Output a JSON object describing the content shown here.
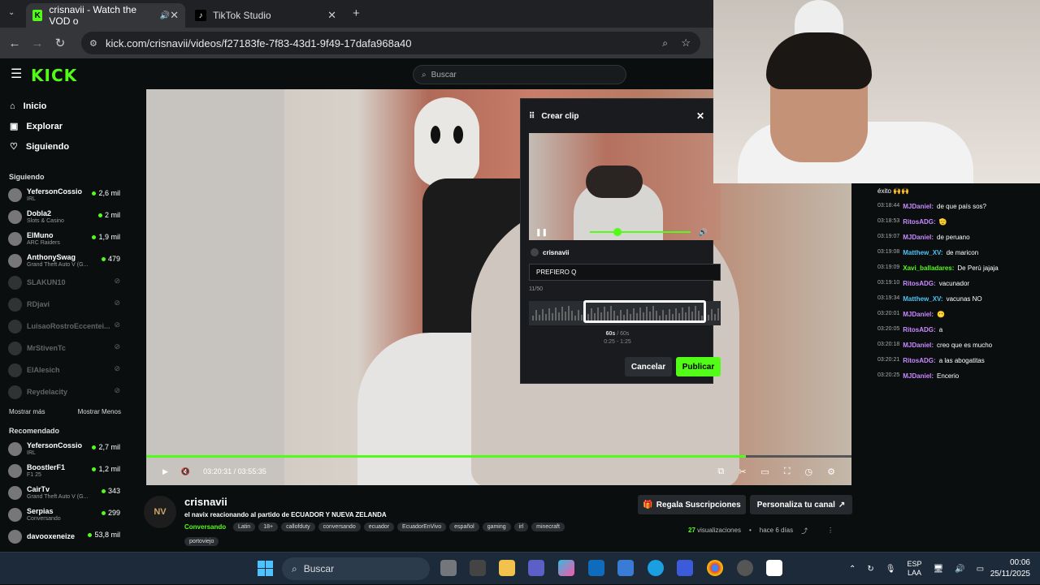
{
  "browser": {
    "tabs": [
      {
        "title": "crisnavii - Watch the VOD o"
      },
      {
        "title": "TikTok Studio"
      }
    ],
    "url": "kick.com/crisnavii/videos/f27183fe-7f83-43d1-9f49-17dafa968a40"
  },
  "header": {
    "logo": "KICK",
    "search_placeholder": "Buscar"
  },
  "sidebar": {
    "nav": [
      {
        "label": "Inicio"
      },
      {
        "label": "Explorar"
      },
      {
        "label": "Siguiendo"
      }
    ],
    "following_title": "Siguiendo",
    "following": [
      {
        "name": "YefersonCossio",
        "game": "IRL",
        "viewers": "2,6 mil",
        "live": true
      },
      {
        "name": "Dobla2",
        "game": "Slots & Casino",
        "viewers": "2 mil",
        "live": true
      },
      {
        "name": "ElMuno",
        "game": "ARC Raiders",
        "viewers": "1,9 mil",
        "live": true
      },
      {
        "name": "AnthonySwag",
        "game": "Grand Theft Auto V (G...",
        "viewers": "479",
        "live": true
      },
      {
        "name": "SLAKUN10",
        "game": "",
        "viewers": "",
        "live": false
      },
      {
        "name": "RDjavi",
        "game": "",
        "viewers": "",
        "live": false
      },
      {
        "name": "LuisaoRostroEccentei...",
        "game": "",
        "viewers": "",
        "live": false
      },
      {
        "name": "MrStivenTc",
        "game": "",
        "viewers": "",
        "live": false
      },
      {
        "name": "ElAlesich",
        "game": "",
        "viewers": "",
        "live": false
      },
      {
        "name": "Reydelacity",
        "game": "",
        "viewers": "",
        "live": false
      }
    ],
    "show_more": "Mostrar más",
    "show_less": "Mostrar Menos",
    "recommended_title": "Recomendado",
    "recommended": [
      {
        "name": "YefersonCossio",
        "game": "IRL",
        "viewers": "2,7 mil"
      },
      {
        "name": "BoostIerF1",
        "game": "F1 25",
        "viewers": "1,2 mil"
      },
      {
        "name": "CairTv",
        "game": "Grand Theft Auto V (G...",
        "viewers": "343"
      },
      {
        "name": "Serpias",
        "game": "Conversando",
        "viewers": "299"
      },
      {
        "name": "davooxeneize",
        "game": "",
        "viewers": "53,8 mil"
      }
    ]
  },
  "player": {
    "time": "03:20:31 / 03:55:35",
    "progress": 0.85
  },
  "clip": {
    "title": "Crear clip",
    "channel": "crisnavii",
    "input_value": "PREFIERO Q",
    "char_count": "11/50",
    "duration": "60s",
    "duration_max": "/ 60s",
    "range": "0:25 - 1:25",
    "cancel": "Cancelar",
    "publish": "Publicar"
  },
  "chat": [
    {
      "ts": "",
      "user": "",
      "text": "éxito 🙌🙌",
      "color": "#ffffff"
    },
    {
      "ts": "03:18:44",
      "user": "MJDaniel:",
      "text": "de que país sos?",
      "color": "#c88bff"
    },
    {
      "ts": "03:18:53",
      "user": "RitosADG:",
      "text": "🫡",
      "color": "#c88bff"
    },
    {
      "ts": "03:19:07",
      "user": "MJDaniel:",
      "text": "de peruano",
      "color": "#c88bff"
    },
    {
      "ts": "03:19:08",
      "user": "Matthew_XV:",
      "text": "de maricon",
      "color": "#4fc3f7"
    },
    {
      "ts": "03:19:09",
      "user": "Xavi_balladares:",
      "text": "De Perú jajaja",
      "color": "#53fc18"
    },
    {
      "ts": "03:19:10",
      "user": "RitosADG:",
      "text": "vacunador",
      "color": "#c88bff"
    },
    {
      "ts": "03:19:34",
      "user": "Matthew_XV:",
      "text": "vacunas NO",
      "color": "#4fc3f7"
    },
    {
      "ts": "03:20:01",
      "user": "MJDaniel:",
      "text": "😶",
      "color": "#c88bff"
    },
    {
      "ts": "03:20:05",
      "user": "RitosADG:",
      "text": "a",
      "color": "#c88bff"
    },
    {
      "ts": "03:20:18",
      "user": "MJDaniel:",
      "text": "creo que es mucho",
      "color": "#c88bff"
    },
    {
      "ts": "03:20:21",
      "user": "RitosADG:",
      "text": "a las abogatitas",
      "color": "#c88bff"
    },
    {
      "ts": "03:20:25",
      "user": "MJDaniel:",
      "text": "Encerio",
      "color": "#c88bff"
    }
  ],
  "stream": {
    "avatar_text": "NV",
    "channel": "crisnavii",
    "title": "el navix  reacionando al partido  de  ECUADOR Y NUEVA ZELANDA",
    "category": "Conversando",
    "tags": [
      "Latin",
      "18+",
      "callofduty",
      "conversando",
      "ecuador",
      "EcuadorEnVivo",
      "español",
      "gaming",
      "irl",
      "minecraft"
    ],
    "tag_extra": "portoviejo",
    "gift_button": "Regala Suscripciones",
    "customize_button": "Personaliza tu canal",
    "views_count": "27",
    "views_label": "visualizaciones",
    "age": "hace 6 días"
  },
  "taskbar": {
    "search": "Buscar",
    "lang1": "ESP",
    "lang2": "LAA",
    "time": "00:06",
    "date": "25/11/2025"
  },
  "colors": {
    "accent": "#53fc18",
    "bg": "#0b0e0f"
  }
}
